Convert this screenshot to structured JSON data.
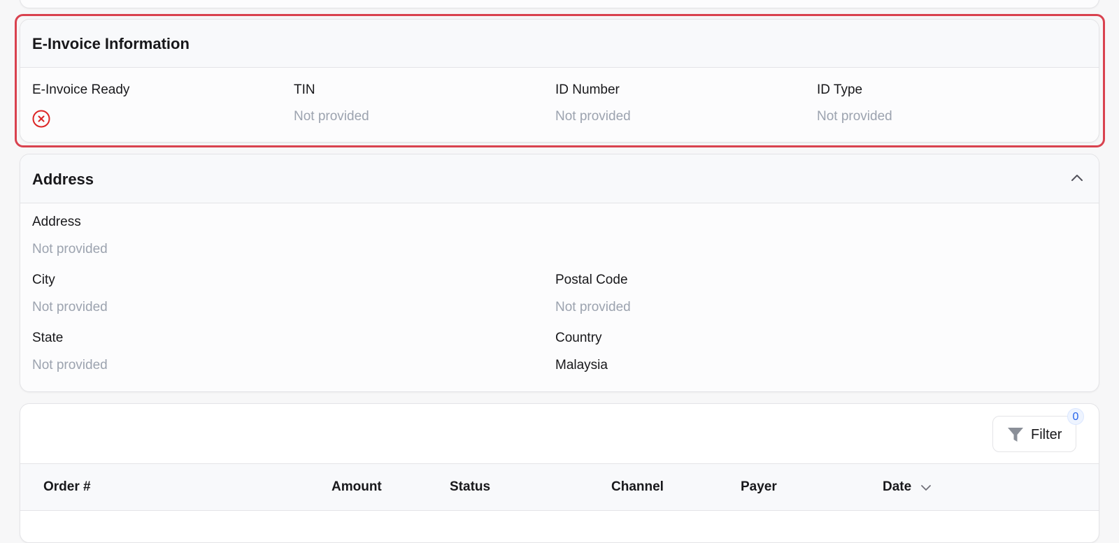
{
  "einvoice": {
    "title": "E-Invoice Information",
    "fields": [
      {
        "label": "E-Invoice Ready",
        "icon": "close-circle-icon"
      },
      {
        "label": "TIN",
        "value": "Not provided"
      },
      {
        "label": "ID Number",
        "value": "Not provided"
      },
      {
        "label": "ID Type",
        "value": "Not provided"
      }
    ]
  },
  "address": {
    "title": "Address",
    "fields": [
      {
        "label": "Address",
        "value": "Not provided"
      },
      {
        "label": "City",
        "value": "Not provided"
      },
      {
        "label": "Postal Code",
        "value": "Not provided"
      },
      {
        "label": "State",
        "value": "Not provided"
      },
      {
        "label": "Country",
        "value": "Malaysia"
      }
    ]
  },
  "orders": {
    "filter_label": "Filter",
    "filter_count": "0",
    "columns": [
      "Order #",
      "Amount",
      "Status",
      "Channel",
      "Payer",
      "Date"
    ]
  },
  "colors": {
    "highlight": "#d9424f",
    "muted_text": "#9ca3af",
    "badge_text": "#2563eb"
  }
}
